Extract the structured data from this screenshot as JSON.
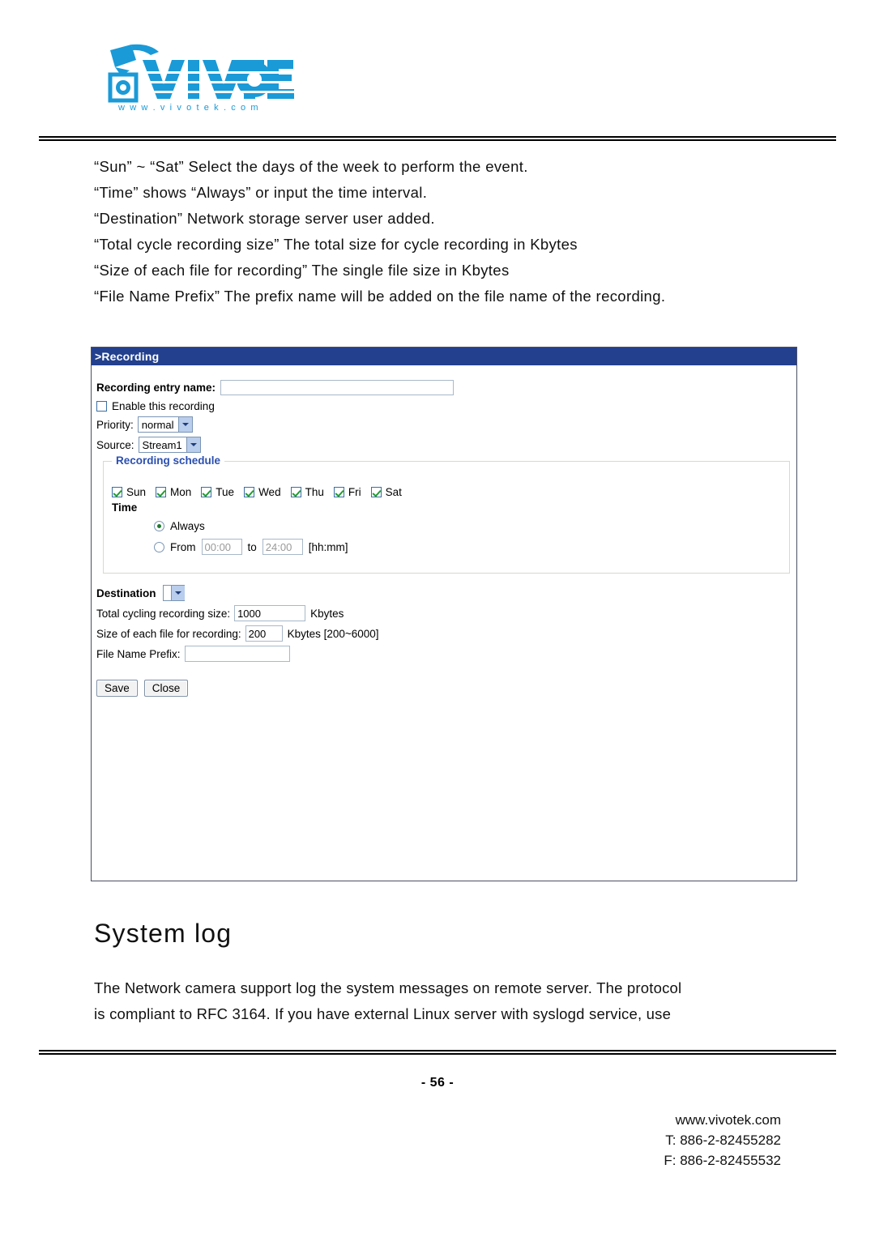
{
  "logo": {
    "brand": "VIVOTEK",
    "tagline": "w w w . v i v o t e k . c o m",
    "color": "#1a9ad7"
  },
  "doc_lines": [
    "“Sun” ~ “Sat” Select the days of the week to perform the event.",
    "“Time” shows “Always” or input the time interval.",
    "“Destination” Network storage server user added.",
    "“Total cycle recording size” The total size for cycle recording in Kbytes",
    "“Size of each file for recording” The single file size in Kbytes",
    "“File Name Prefix” The prefix name will be added on the file name of the recording."
  ],
  "panel": {
    "header_title": ">Recording",
    "header_bg": "#23408e",
    "entry_name_label": "Recording entry name:",
    "entry_name_value": "",
    "entry_name_placeholder": "",
    "enable_label": "Enable this recording",
    "enable_checked": false,
    "priority_label": "Priority:",
    "priority_value": "normal",
    "source_label": "Source:",
    "source_value": "Stream1",
    "schedule": {
      "legend": "Recording schedule",
      "legend_color": "#2a4fb0",
      "days": [
        {
          "label": "Sun",
          "checked": true
        },
        {
          "label": "Mon",
          "checked": true
        },
        {
          "label": "Tue",
          "checked": true
        },
        {
          "label": "Wed",
          "checked": true
        },
        {
          "label": "Thu",
          "checked": true
        },
        {
          "label": "Fri",
          "checked": true
        },
        {
          "label": "Sat",
          "checked": true
        }
      ],
      "time_label": "Time",
      "always_label": "Always",
      "always_selected": true,
      "from_label": "From",
      "from_value": "00:00",
      "to_label": "to",
      "to_value": "24:00",
      "format_hint": "[hh:mm]",
      "interval_selected": false
    },
    "destination_label": "Destination",
    "destination_value": "",
    "total_size_label": "Total cycling recording size:",
    "total_size_value": "1000",
    "total_size_unit": "Kbytes",
    "each_file_label": "Size of each file for recording:",
    "each_file_value": "200",
    "each_file_unit": "Kbytes [200~6000]",
    "prefix_label": "File Name Prefix:",
    "prefix_value": "",
    "save_label": "Save",
    "close_label": "Close"
  },
  "system_log": {
    "heading": "System log",
    "paragraph_lines": [
      "The Network camera support log the system messages on remote server. The protocol",
      "is compliant to RFC 3164. If you have external Linux server with syslogd service, use"
    ]
  },
  "footer": {
    "page_number": "- 56 -",
    "website": "www.vivotek.com",
    "telephone": "T: 886-2-82455282",
    "fax": "F: 886-2-82455532"
  }
}
